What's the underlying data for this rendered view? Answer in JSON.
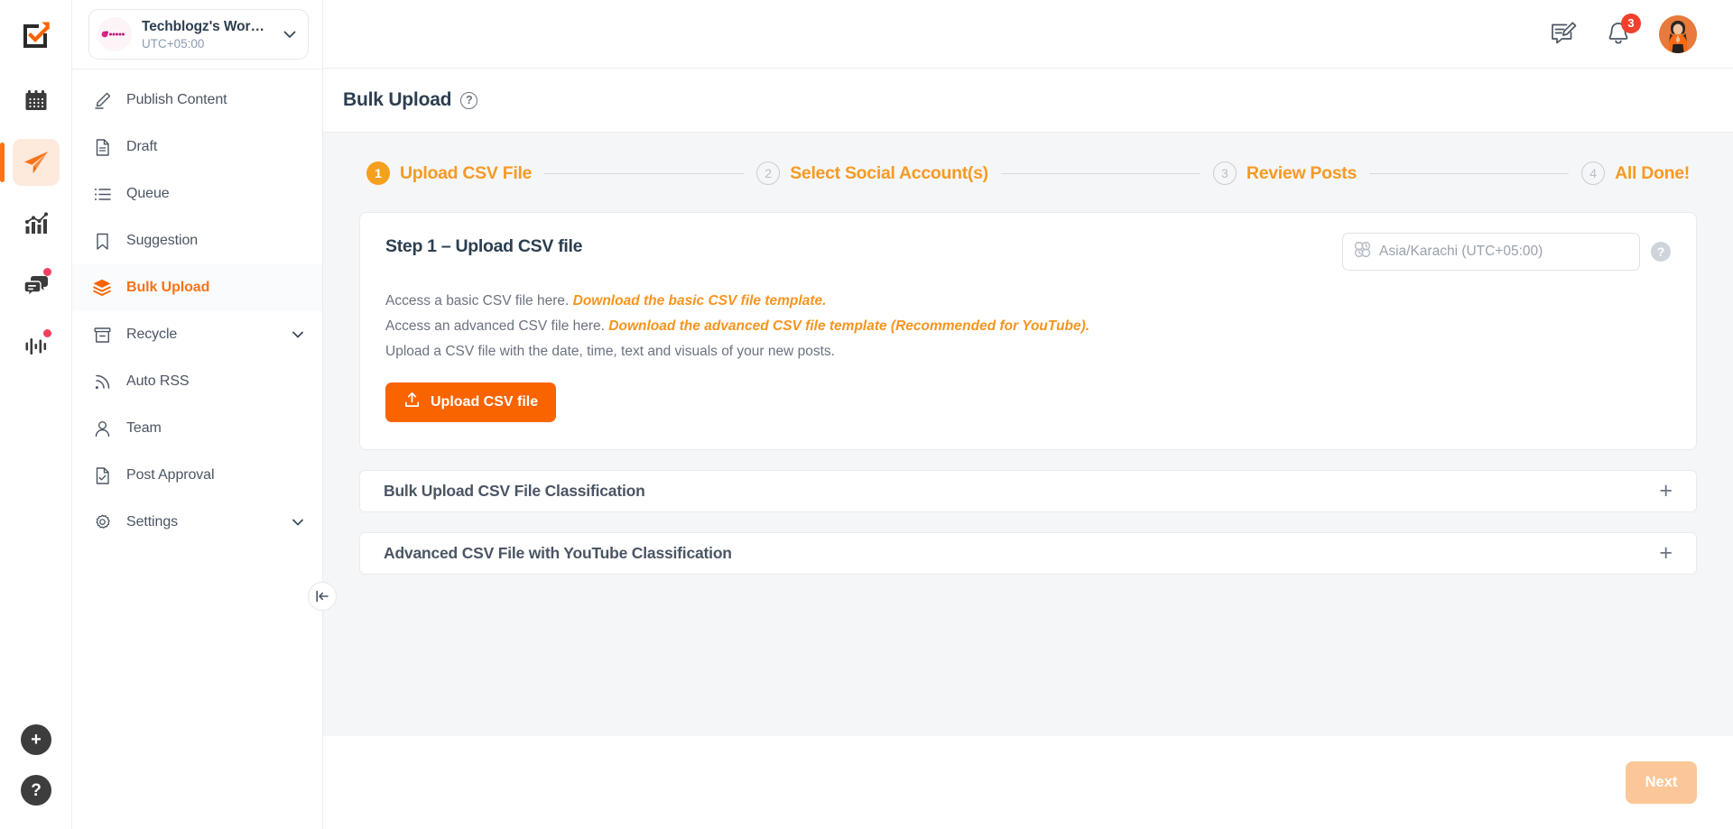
{
  "rail": {
    "logo_icon": "checkmark-arrow-logo",
    "items": [
      {
        "icon": "calendar-icon",
        "name": "calendar",
        "active": false,
        "dot": false
      },
      {
        "icon": "paper-plane-icon",
        "name": "publish",
        "active": true,
        "dot": false
      },
      {
        "icon": "analytics-chart-icon",
        "name": "analytics",
        "active": false,
        "dot": false
      },
      {
        "icon": "chat-bubbles-icon",
        "name": "inbox",
        "active": false,
        "dot": true
      },
      {
        "icon": "audio-bars-icon",
        "name": "listening",
        "active": false,
        "dot": true
      }
    ],
    "add_label": "+",
    "help_label": "?"
  },
  "workspace": {
    "name": "Techblogz's Worksp...",
    "timezone": "UTC+05:00",
    "avatar_icon": "workspace-avatar",
    "chevron_icon": "chevron-down-icon"
  },
  "sidebar": {
    "items": [
      {
        "label": "Publish Content",
        "icon": "pencil-icon",
        "active": false,
        "expandable": false
      },
      {
        "label": "Draft",
        "icon": "document-icon",
        "active": false,
        "expandable": false
      },
      {
        "label": "Queue",
        "icon": "list-icon",
        "active": false,
        "expandable": false
      },
      {
        "label": "Suggestion",
        "icon": "bookmark-icon",
        "active": false,
        "expandable": false
      },
      {
        "label": "Bulk Upload",
        "icon": "layers-icon",
        "active": true,
        "expandable": false
      },
      {
        "label": "Recycle",
        "icon": "archive-icon",
        "active": false,
        "expandable": true
      },
      {
        "label": "Auto RSS",
        "icon": "rss-icon",
        "active": false,
        "expandable": false
      },
      {
        "label": "Team",
        "icon": "user-icon",
        "active": false,
        "expandable": false
      },
      {
        "label": "Post Approval",
        "icon": "document-check-icon",
        "active": false,
        "expandable": false
      },
      {
        "label": "Settings",
        "icon": "gear-icon",
        "active": false,
        "expandable": true
      }
    ],
    "collapse_icon": "collapse-sidebar-icon"
  },
  "topbar": {
    "compose_icon": "compose-message-icon",
    "notifications_icon": "bell-icon",
    "notifications_count": "3",
    "avatar_icon": "user-avatar"
  },
  "page": {
    "title": "Bulk Upload",
    "help_icon": "question-mark-icon",
    "help_label": "?"
  },
  "stepper": {
    "steps": [
      {
        "num": "1",
        "label": "Upload CSV File",
        "state": "active"
      },
      {
        "num": "2",
        "label": "Select Social Account(s)",
        "state": "todo"
      },
      {
        "num": "3",
        "label": "Review Posts",
        "state": "todo"
      },
      {
        "num": "4",
        "label": "All Done!",
        "state": "todo"
      }
    ]
  },
  "step_card": {
    "title": "Step 1 – Upload CSV file",
    "timezone": {
      "icon": "timezone-clock-icon",
      "value": "Asia/Karachi (UTC+05:00)",
      "help_label": "?",
      "help_icon": "question-mark-icon"
    },
    "lines": [
      {
        "text": "Access a basic CSV file here. ",
        "link": "Download the basic CSV file template."
      },
      {
        "text": "Access an advanced CSV file here. ",
        "link": "Download the advanced CSV file template (Recommended for YouTube)."
      },
      {
        "text": "Upload a CSV file with the date, time, text and visuals of your new posts.",
        "link": ""
      }
    ],
    "upload_button": {
      "label": "Upload CSV file",
      "icon": "upload-icon"
    }
  },
  "accordions": [
    {
      "title": "Bulk Upload CSV File Classification",
      "toggle": "+",
      "icon": "plus-icon"
    },
    {
      "title": "Advanced CSV File with YouTube Classification",
      "toggle": "+",
      "icon": "plus-icon"
    }
  ],
  "footer": {
    "next_label": "Next",
    "next_disabled": true
  },
  "colors": {
    "accent_orange": "#fa6400",
    "step_orange": "#f79a24",
    "link_orange": "#f7941e",
    "badge_red": "#f0412c",
    "dot_pink": "#f43f5e",
    "text_dark": "#2c3e50",
    "content_bg": "#f5f6f7",
    "next_disabled": "#fbc799"
  }
}
